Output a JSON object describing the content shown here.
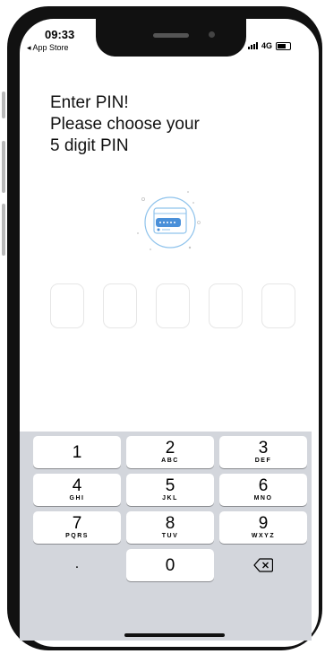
{
  "status_bar": {
    "time": "09:33",
    "back_label": "◂ App Store",
    "network": "4G"
  },
  "main": {
    "title_lines": [
      "Enter PIN!",
      "Please choose your",
      "5 digit PIN"
    ],
    "pin_icon": "pin-card-icon",
    "pin_box_count": 5
  },
  "keypad": {
    "keys": [
      {
        "num": "1",
        "letters": ""
      },
      {
        "num": "2",
        "letters": "ABC"
      },
      {
        "num": "3",
        "letters": "DEF"
      },
      {
        "num": "4",
        "letters": "GHI"
      },
      {
        "num": "5",
        "letters": "JKL"
      },
      {
        "num": "6",
        "letters": "MNO"
      },
      {
        "num": "7",
        "letters": "PQRS"
      },
      {
        "num": "8",
        "letters": "TUV"
      },
      {
        "num": "9",
        "letters": "WXYZ"
      },
      {
        "num": "0",
        "letters": ""
      }
    ],
    "dot_label": ".",
    "delete_icon": "backspace-icon"
  },
  "colors": {
    "accent": "#4a90d9",
    "keyboard_bg": "#d3d6dc"
  }
}
